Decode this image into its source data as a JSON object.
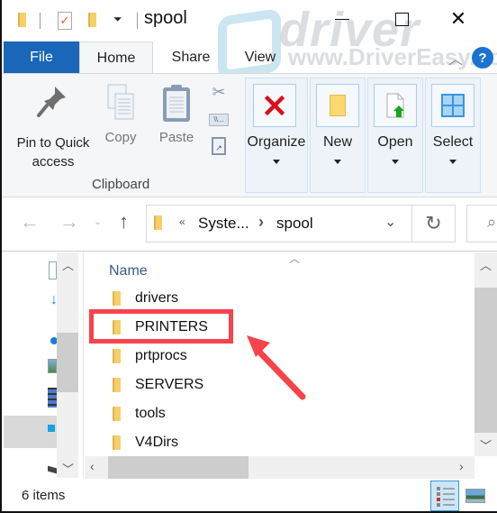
{
  "window": {
    "title": "spool",
    "minimize": "—",
    "close": "✕"
  },
  "watermark": {
    "brand": "driver easy",
    "url": "www.DriverEasy.com"
  },
  "tabs": [
    {
      "label": "File"
    },
    {
      "label": "Home"
    },
    {
      "label": "Share"
    },
    {
      "label": "View"
    }
  ],
  "help_label": "?",
  "ribbon": {
    "clipboard": {
      "pin_label_line1": "Pin to Quick",
      "pin_label_line2": "access",
      "copy_label": "Copy",
      "paste_label": "Paste",
      "group_label": "Clipboard"
    },
    "groups": [
      {
        "label": "Organize"
      },
      {
        "label": "New"
      },
      {
        "label": "Open"
      },
      {
        "label": "Select"
      }
    ]
  },
  "address": {
    "overflow": "«",
    "crumbs": [
      "Syste...",
      "spool"
    ],
    "separator": "›"
  },
  "content": {
    "column_header": "Name",
    "items": [
      {
        "name": "drivers",
        "highlighted": false
      },
      {
        "name": "PRINTERS",
        "highlighted": true
      },
      {
        "name": "prtprocs",
        "highlighted": false
      },
      {
        "name": "SERVERS",
        "highlighted": false
      },
      {
        "name": "tools",
        "highlighted": false
      },
      {
        "name": "V4Dirs",
        "highlighted": false
      }
    ]
  },
  "status": {
    "item_count": "6 items"
  },
  "annotation": {
    "color": "#f6434c",
    "target": "PRINTERS"
  }
}
